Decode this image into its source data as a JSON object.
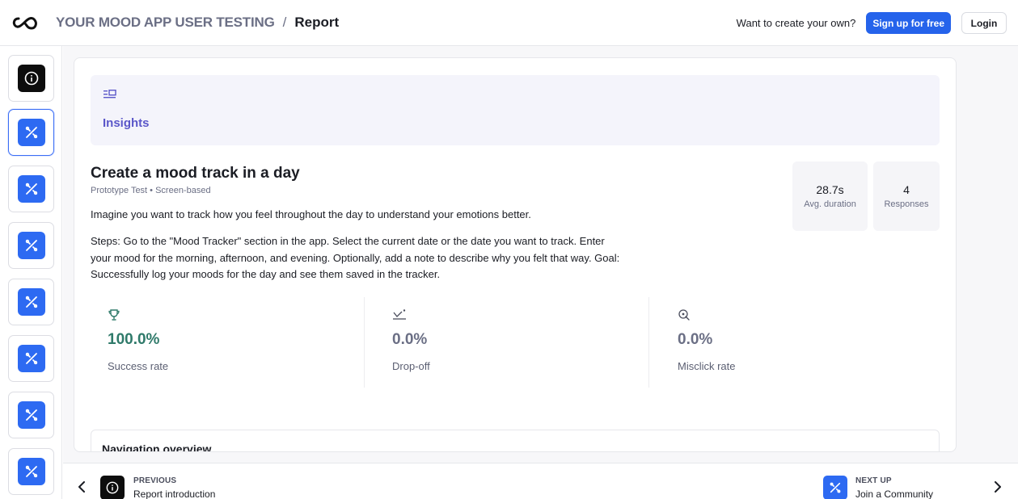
{
  "header": {
    "project_name": "YOUR MOOD APP USER TESTING",
    "separator": "/",
    "page_title": "Report",
    "promo_text": "Want to create your own?",
    "signup_label": "Sign up for free",
    "login_label": "Login",
    "logo_icon": "infinity-logo-icon"
  },
  "rail": {
    "items": [
      {
        "icon": "info-icon",
        "tile_color": "#0d0d0d",
        "active": false
      },
      {
        "icon": "prototype-icon",
        "tile_color": "#2d6af2",
        "active": true
      },
      {
        "icon": "prototype-icon",
        "tile_color": "#2d6af2",
        "active": false
      },
      {
        "icon": "prototype-icon",
        "tile_color": "#2d6af2",
        "active": false
      },
      {
        "icon": "prototype-icon",
        "tile_color": "#2d6af2",
        "active": false
      },
      {
        "icon": "prototype-icon",
        "tile_color": "#2d6af2",
        "active": false
      },
      {
        "icon": "prototype-icon",
        "tile_color": "#2d6af2",
        "active": false
      },
      {
        "icon": "prototype-icon",
        "tile_color": "#2d6af2",
        "active": false
      }
    ]
  },
  "insights": {
    "label": "Insights",
    "icon": "insights-icon"
  },
  "task": {
    "title": "Create a mood track in a day",
    "subtitle": "Prototype Test • Screen-based",
    "description": "Imagine you want to track how you feel throughout the day to understand your emotions better.",
    "steps": "Steps: Go to the \"Mood Tracker\" section in the app. Select the current date or the date you want to track. Enter your mood for the morning, afternoon, and evening. Optionally, add a note to describe why you felt that way. Goal: Successfully log your moods for the day and see them saved in the tracker."
  },
  "stats": {
    "duration": {
      "value": "28.7s",
      "label": "Avg. duration"
    },
    "responses": {
      "value": "4",
      "label": "Responses"
    }
  },
  "metrics": [
    {
      "icon": "trophy-icon",
      "value": "100.0%",
      "label": "Success rate",
      "color": "#2f7a6a"
    },
    {
      "icon": "drop-off-icon",
      "value": "0.0%",
      "label": "Drop-off",
      "color": "#6b6f85"
    },
    {
      "icon": "misclick-icon",
      "value": "0.0%",
      "label": "Misclick rate",
      "color": "#6b6f85"
    }
  ],
  "navigation_overview": {
    "title": "Navigation overview"
  },
  "footer": {
    "previous": {
      "kicker": "PREVIOUS",
      "name": "Report introduction"
    },
    "next": {
      "kicker": "NEXT UP",
      "name": "Join a Community"
    }
  },
  "colors": {
    "accent": "#2563eb",
    "insights_purple": "#5b57c9",
    "success_green": "#2f7a6a"
  }
}
